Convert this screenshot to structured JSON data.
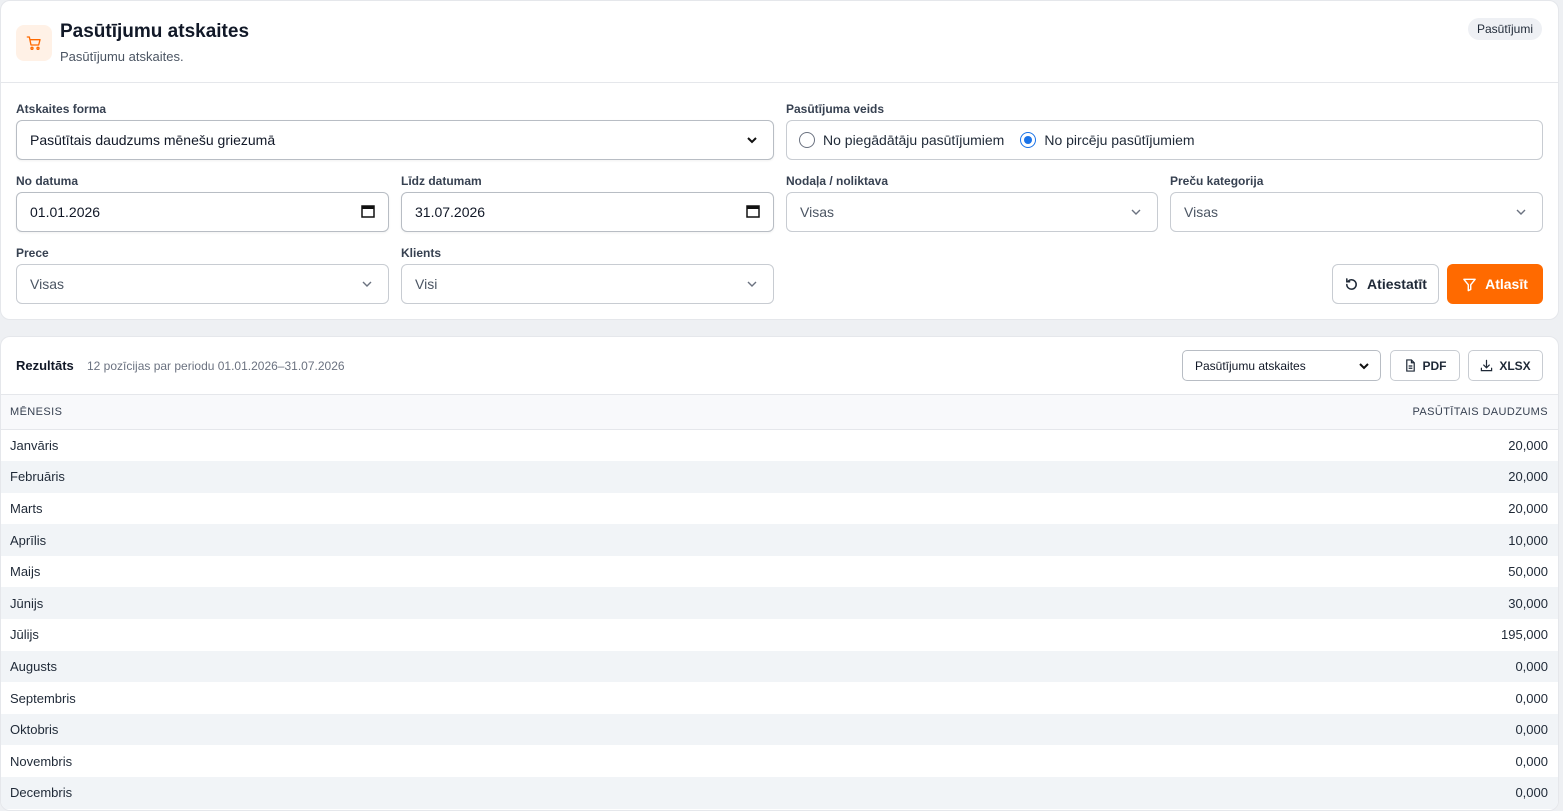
{
  "header": {
    "title": "Pasūtījumu atskaites",
    "subtitle": "Pasūtījumu atskaites.",
    "badge": "Pasūtījumi"
  },
  "filters": {
    "report_form_label": "Atskaites forma",
    "report_form_value": "Pasūtītais daudzums mēnešu griezumā",
    "order_type_label": "Pasūtījuma veids",
    "order_type_options": [
      {
        "label": "No piegādātāju pasūtījumiem",
        "selected": false
      },
      {
        "label": "No pircēju pasūtījumiem",
        "selected": true
      }
    ],
    "date_from_label": "No datuma",
    "date_from_value": "01.01.2026",
    "date_to_label": "Līdz datumam",
    "date_to_value": "31.07.2026",
    "department_label": "Nodaļa / noliktava",
    "department_value": "Visas",
    "category_label": "Preču kategorija",
    "category_value": "Visas",
    "product_label": "Prece",
    "product_value": "Visas",
    "client_label": "Klients",
    "client_value": "Visi",
    "reset_label": "Atiestatīt",
    "apply_label": "Atlasīt",
    "accent_color": "#ff6a00"
  },
  "results": {
    "title": "Rezultāts",
    "meta": "12 pozīcijas par periodu 01.01.2026–31.07.2026",
    "export_select_value": "Pasūtījumu atskaites",
    "pdf_label": "PDF",
    "xlsx_label": "XLSX",
    "columns": [
      "MĒNESIS",
      "PASŪTĪTAIS DAUDZUMS"
    ],
    "rows": [
      {
        "month": "Janvāris",
        "qty": "20,000"
      },
      {
        "month": "Februāris",
        "qty": "20,000"
      },
      {
        "month": "Marts",
        "qty": "20,000"
      },
      {
        "month": "Aprīlis",
        "qty": "10,000"
      },
      {
        "month": "Maijs",
        "qty": "50,000"
      },
      {
        "month": "Jūnijs",
        "qty": "30,000"
      },
      {
        "month": "Jūlijs",
        "qty": "195,000"
      },
      {
        "month": "Augusts",
        "qty": "0,000"
      },
      {
        "month": "Septembris",
        "qty": "0,000"
      },
      {
        "month": "Oktobris",
        "qty": "0,000"
      },
      {
        "month": "Novembris",
        "qty": "0,000"
      },
      {
        "month": "Decembris",
        "qty": "0,000"
      }
    ]
  }
}
